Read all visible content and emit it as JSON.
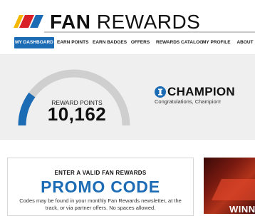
{
  "header": {
    "brand_bold": "FAN",
    "brand_light": "REWARDS"
  },
  "nav": {
    "items": [
      {
        "label": "MY DASHBOARD",
        "active": true
      },
      {
        "label": "EARN POINTS",
        "active": false
      },
      {
        "label": "EARN BADGES",
        "active": false
      },
      {
        "label": "OFFERS",
        "active": false
      },
      {
        "label": "REWARDS CATALOG",
        "active": false
      },
      {
        "label": "MY PROFILE",
        "active": false
      },
      {
        "label": "ABOUT",
        "active": false
      }
    ]
  },
  "points": {
    "label": "REWARD POINTS",
    "value": "10,162",
    "gauge_fill_fraction": 0.2
  },
  "tier": {
    "name": "CHAMPION",
    "message": "Congratulations, Champion!"
  },
  "promo": {
    "title": "ENTER A VALID FAN REWARDS",
    "heading": "PROMO CODE",
    "help": "Codes may be found in your monthly Fan Rewards newsletter, at the track, or via partner offers. No spaces allowed."
  },
  "banner": {
    "text": "WINN"
  },
  "colors": {
    "accent": "#1c6bb5",
    "gauge_track": "#cfcfcf",
    "band_bg": "#efefef",
    "logo_yellow": "#f5b800",
    "logo_red": "#d92027",
    "logo_blue": "#1c6bb5"
  }
}
